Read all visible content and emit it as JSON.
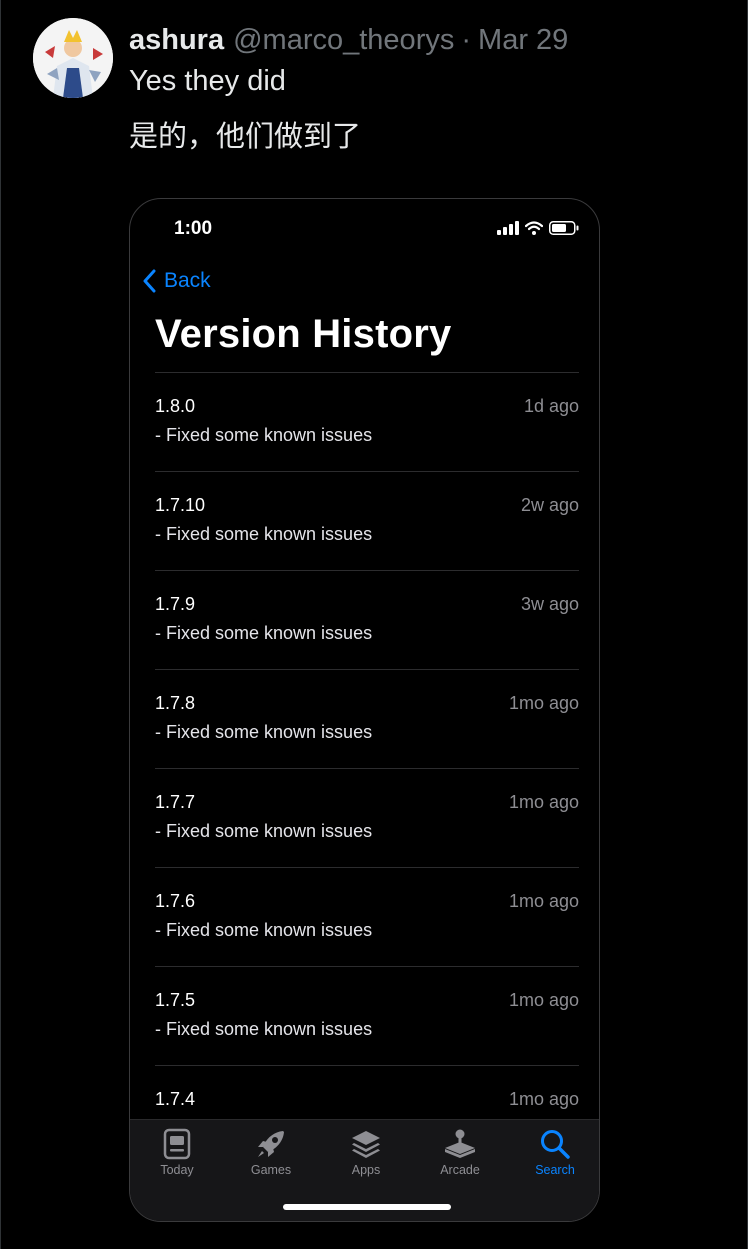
{
  "tweet": {
    "author_name": "ashura",
    "author_handle": "@marco_theorys",
    "separator": "·",
    "date": "Mar 29",
    "text_lines": [
      "Yes they did",
      "是的，他们做到了"
    ]
  },
  "phone": {
    "status_time": "1:00",
    "back_label": "Back",
    "title": "Version History",
    "versions": [
      {
        "version": "1.8.0",
        "ago": "1d ago",
        "notes": "- Fixed some known issues"
      },
      {
        "version": "1.7.10",
        "ago": "2w ago",
        "notes": "- Fixed some known issues"
      },
      {
        "version": "1.7.9",
        "ago": "3w ago",
        "notes": "- Fixed some known issues"
      },
      {
        "version": "1.7.8",
        "ago": "1mo ago",
        "notes": "- Fixed some known issues"
      },
      {
        "version": "1.7.7",
        "ago": "1mo ago",
        "notes": "- Fixed some known issues"
      },
      {
        "version": "1.7.6",
        "ago": "1mo ago",
        "notes": "- Fixed some known issues"
      },
      {
        "version": "1.7.5",
        "ago": "1mo ago",
        "notes": "- Fixed some known issues"
      },
      {
        "version": "1.7.4",
        "ago": "1mo ago",
        "notes": ""
      }
    ],
    "tabs": [
      {
        "label": "Today",
        "icon": "today-icon",
        "active": false
      },
      {
        "label": "Games",
        "icon": "rocket-icon",
        "active": false
      },
      {
        "label": "Apps",
        "icon": "layers-icon",
        "active": false
      },
      {
        "label": "Arcade",
        "icon": "joystick-icon",
        "active": false
      },
      {
        "label": "Search",
        "icon": "search-icon",
        "active": true
      }
    ],
    "colors": {
      "accent": "#0a84ff",
      "inactive": "#8e8e93"
    }
  }
}
